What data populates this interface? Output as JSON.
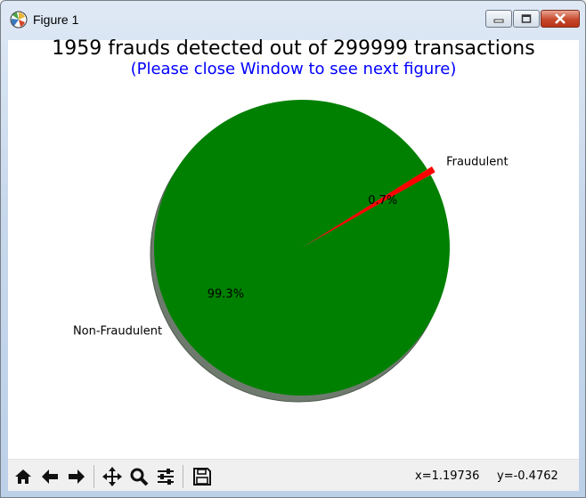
{
  "window": {
    "title": "Figure 1"
  },
  "figure": {
    "title": "1959 frauds detected out of 299999 transactions",
    "subtitle": "(Please close Window to see next figure)",
    "colors": {
      "subtitle": "#0000ff",
      "non_fraud": "#008000",
      "fraud": "#ff0000",
      "shadow": "#6f7a6f"
    }
  },
  "chart_data": {
    "type": "pie",
    "title": "1959 frauds detected out of 299999 transactions",
    "slices": [
      {
        "label": "Non-Fraudulent",
        "value": 99.3,
        "pct_label": "99.3%",
        "color": "#008000"
      },
      {
        "label": "Fraudulent",
        "value": 0.7,
        "pct_label": "0.7%",
        "color": "#ff0000",
        "exploded": true
      }
    ],
    "shadow": true
  },
  "toolbar": {
    "buttons": [
      "home-icon",
      "back-icon",
      "forward-icon",
      "pan-icon",
      "zoom-icon",
      "configure-icon",
      "save-icon"
    ],
    "x_readout": "x=1.19736",
    "y_readout": "y=-0.4762"
  }
}
